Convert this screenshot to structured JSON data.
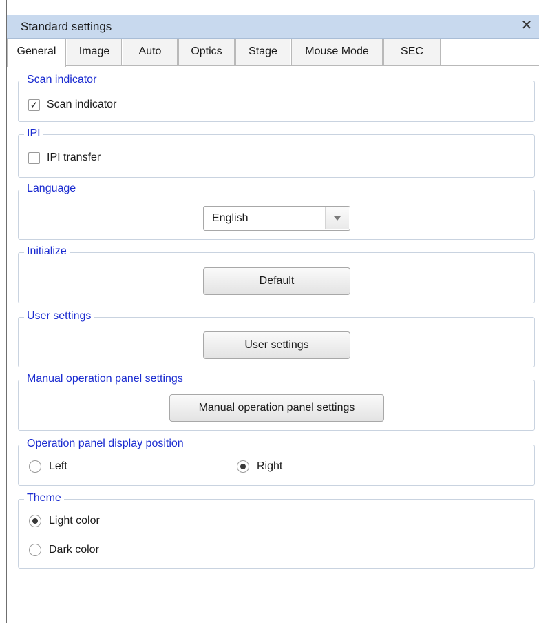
{
  "window": {
    "title": "Standard settings",
    "close_glyph": "✕"
  },
  "tabs": [
    {
      "label": "General",
      "active": true
    },
    {
      "label": "Image"
    },
    {
      "label": "Auto"
    },
    {
      "label": "Optics"
    },
    {
      "label": "Stage"
    },
    {
      "label": "Mouse Mode"
    },
    {
      "label": "SEC"
    }
  ],
  "scan_indicator": {
    "legend": "Scan indicator",
    "checkbox_label": "Scan indicator",
    "checked": true,
    "check_glyph": "✓"
  },
  "ipi": {
    "legend": "IPI",
    "checkbox_label": "IPI transfer",
    "checked": false
  },
  "language": {
    "legend": "Language",
    "selected": "English"
  },
  "initialize": {
    "legend": "Initialize",
    "button_label": "Default"
  },
  "user_settings": {
    "legend": "User settings",
    "button_label": "User settings"
  },
  "manual_panel": {
    "legend": "Manual operation panel settings",
    "button_label": "Manual operation panel settings"
  },
  "panel_position": {
    "legend": "Operation panel display position",
    "options": [
      {
        "label": "Left",
        "selected": false
      },
      {
        "label": "Right",
        "selected": true
      }
    ]
  },
  "theme": {
    "legend": "Theme",
    "options": [
      {
        "label": "Light color",
        "selected": true
      },
      {
        "label": "Dark color",
        "selected": false
      }
    ]
  },
  "colors": {
    "legend": "#1a2bd0",
    "titlebar": "#c8d9ee",
    "group_border": "#c9d3e0"
  }
}
